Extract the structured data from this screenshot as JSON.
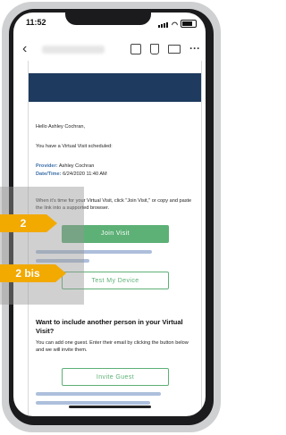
{
  "status": {
    "time": "11:52"
  },
  "email": {
    "greeting": "Hello Ashley Cochran,",
    "intro": "You have a Virtual Visit scheduled:",
    "provider_label": "Provider:",
    "provider_value": "Ashley Cochran",
    "datetime_label": "Date/Time:",
    "datetime_value": "6/24/2020 11:40 AM",
    "instructions": "When it's time for your Virtual Visit, click \"Join Visit,\" or copy and paste the link into a supported browser.",
    "join_button": "Join Visit",
    "test_button": "Test My Device",
    "invite_heading": "Want to include another person in your Virtual Visit?",
    "invite_text": "You can add one guest. Enter their email by clicking the button below and we will invite them.",
    "invite_button": "Invite Guest"
  },
  "annotations": {
    "marker_1": "2",
    "marker_2": "2 bis"
  },
  "colors": {
    "accent_green": "#5db076",
    "banner_navy": "#1e3a5f",
    "marker_orange": "#f2a900"
  }
}
